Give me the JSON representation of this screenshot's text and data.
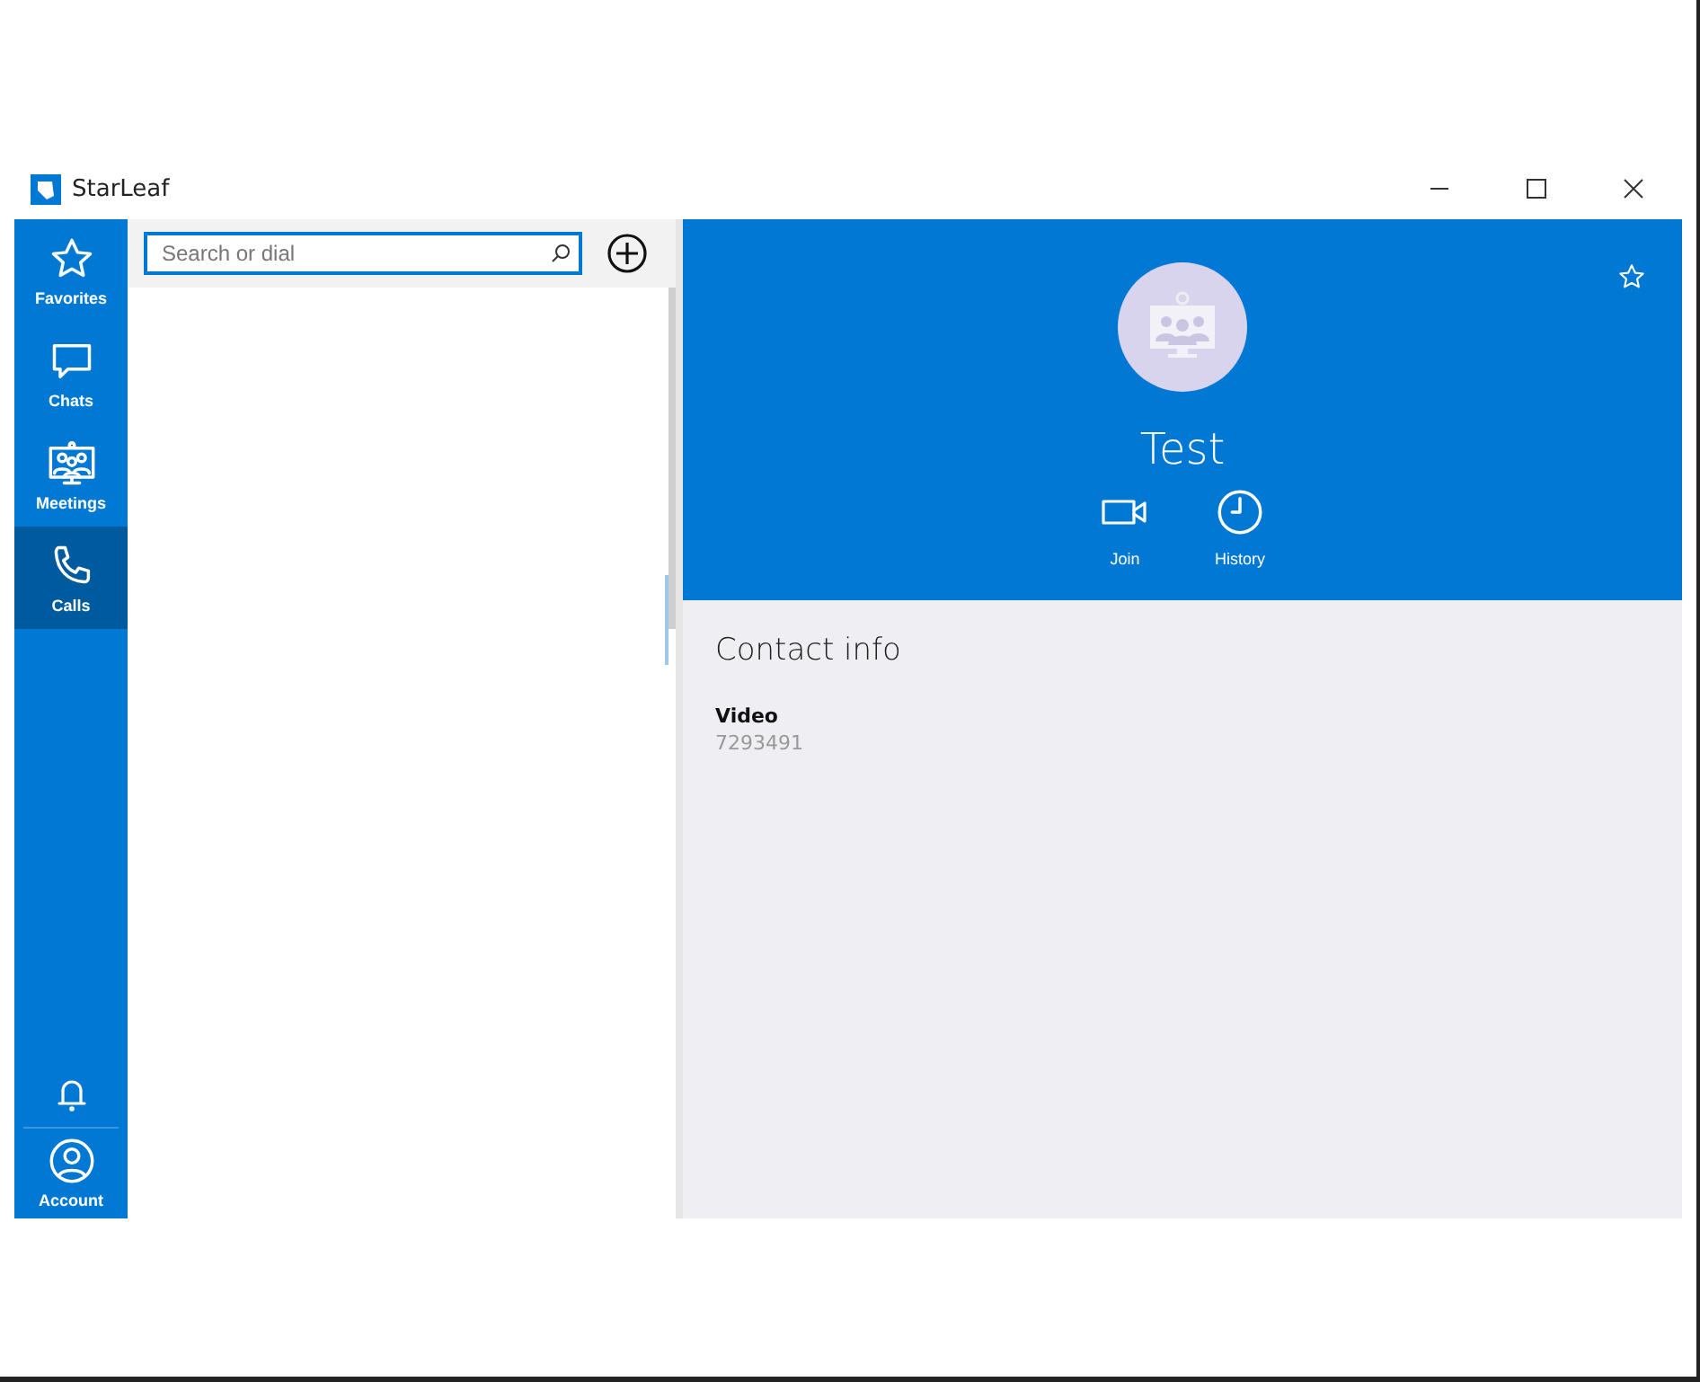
{
  "window": {
    "title": "StarLeaf"
  },
  "nav": [
    {
      "kind": "star",
      "label": "Favorites",
      "selected": false
    },
    {
      "kind": "chat",
      "label": "Chats",
      "selected": false
    },
    {
      "kind": "meeting",
      "label": "Meetings",
      "selected": false
    },
    {
      "kind": "phone",
      "label": "Calls",
      "selected": true
    }
  ],
  "nav_bottom": [
    {
      "kind": "bell"
    },
    {
      "kind": "account",
      "label": "Account"
    }
  ],
  "search": {
    "placeholder": "Search or dial"
  },
  "contact": {
    "name": "Test",
    "actions": [
      {
        "kind": "video",
        "label": "Join"
      },
      {
        "kind": "history",
        "label": "History"
      }
    ],
    "section_title": "Contact info",
    "fields": [
      {
        "label": "Video",
        "value": "7293491"
      }
    ]
  }
}
